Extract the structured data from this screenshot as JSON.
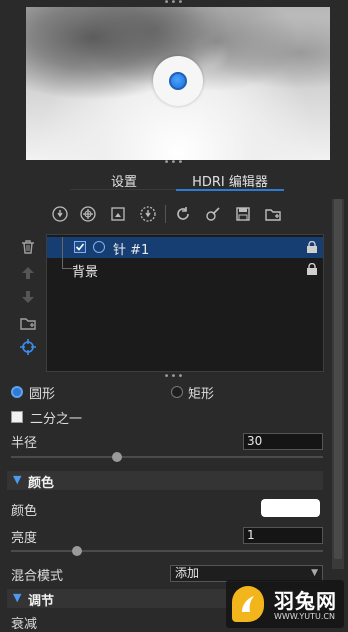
{
  "tabs": [
    {
      "label": "设置",
      "active": false
    },
    {
      "label": "HDRI 编辑器",
      "active": true
    }
  ],
  "toolbar": {
    "left_icons": [
      "pin-add-icon",
      "globe-add-icon",
      "image-add-icon",
      "adjust-add-icon"
    ],
    "right_icons": [
      "refresh-icon",
      "paint-icon",
      "save-icon",
      "folder-open-icon"
    ]
  },
  "side_buttons": [
    "trash-icon",
    "arrow-up-icon",
    "arrow-down-icon",
    "folder-add-icon",
    "target-icon"
  ],
  "list": {
    "items": [
      {
        "label": "针 #1",
        "selected": true,
        "checked": true,
        "locked": true
      },
      {
        "label": "背景",
        "selected": false,
        "locked": true
      }
    ]
  },
  "shape": {
    "options": [
      {
        "label": "圆形",
        "selected": true
      },
      {
        "label": "矩形",
        "selected": false
      }
    ]
  },
  "half": {
    "label": "二分之一",
    "checked": false
  },
  "radius": {
    "label": "半径",
    "value": "30",
    "slider_fraction": 0.34
  },
  "color_section": {
    "title": "颜色",
    "color_label": "颜色",
    "color_value": "#ffffff",
    "brightness_label": "亮度",
    "brightness_value": "1",
    "brightness_slider_fraction": 0.21
  },
  "blend": {
    "label": "混合模式",
    "value": "添加"
  },
  "adjust_section": {
    "title": "调节"
  },
  "falloff": {
    "label": "衰减"
  },
  "watermark": {
    "title": "羽兔网",
    "url": "WWW.YUTU.CN"
  },
  "colors": {
    "accent": "#2d7bd2",
    "selection": "#173e72",
    "panel": "#2a2a2a"
  }
}
